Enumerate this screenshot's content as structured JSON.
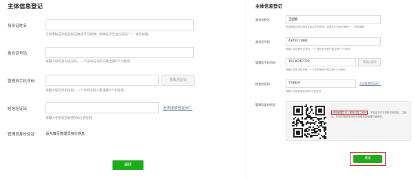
{
  "left": {
    "title": "主体信息登记",
    "fields": {
      "name": {
        "label": "身份证姓名",
        "hint": "信息审核成功后身份证姓名不可修改；如果名字包含分隔号“·”，请勿省略。"
      },
      "id": {
        "label": "身份证号码",
        "hint": "请输入您的身份证号码。一个身份证号码只能注册5个小程序。"
      },
      "phone": {
        "label": "管理员手机号码",
        "button": "获取验证码",
        "hint": "请输入您的手机号码，一个手机号码只能注册5个小程序。"
      },
      "sms": {
        "label": "短信验证码",
        "link": "无法接收验证码？",
        "hint": "请输入手机短信收到的6位验证码"
      },
      "verify": {
        "label": "管理员身份验证",
        "value": "请先填写管理员身份信息"
      }
    },
    "continue_label": "继续"
  },
  "right": {
    "title": "主体信息登记",
    "fields": {
      "name": {
        "label": "身份证姓名",
        "value": "王国能",
        "hint": "信息审核成功后身份证姓名不可修改；如果名字包含分隔号“·”，请勿省略。"
      },
      "id": {
        "label": "身份证号码",
        "value": "4305211991",
        "hint": "请输入您的身份证号码。一个身份证号码只能注册5个小程序。"
      },
      "phone": {
        "label": "管理员手机号码",
        "value": "15136267770",
        "button": "获取验证码",
        "hint": "请输入您的手机号码，一个手机号码只能注册5个小程序。"
      },
      "sms": {
        "label": "短信验证码",
        "value": "774929",
        "link": "无法接收验证码？",
        "hint": "请输入手机短信收到的6位验证码"
      },
      "verify": {
        "label": "管理员身份验证",
        "qr_boxed_text": "请用管理员本人微信扫描二维码",
        "qr_text": "。本验证方式不扣除任何费用。注册后，扫码的微信号将成为该账号的管理员微信号。"
      }
    },
    "continue_label": "继续"
  },
  "colors": {
    "accent": "#1aad19",
    "link": "#576b95",
    "highlight": "#e02020"
  }
}
